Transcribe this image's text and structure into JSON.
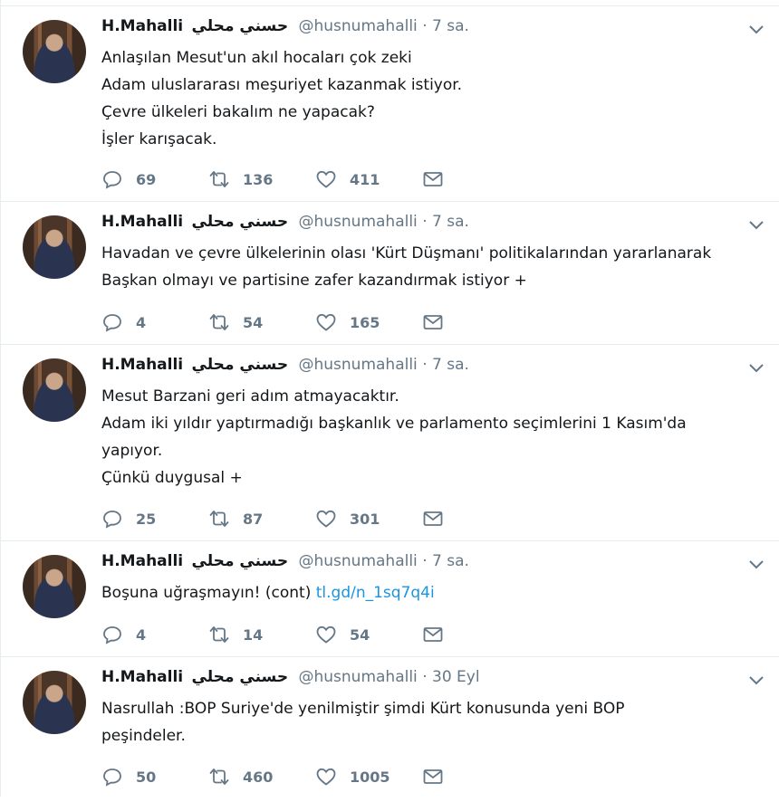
{
  "user": {
    "name": "H.Mahalli",
    "arabic_name": "حسني محلي",
    "handle": "@husnumahalli",
    "separator": "·"
  },
  "icons": {
    "reply": "reply-icon",
    "retweet": "retweet-icon",
    "like": "heart-icon",
    "dm": "direct-message-icon",
    "menu": "chevron-down-icon"
  },
  "colors": {
    "link": "#1b95e0",
    "muted": "#657786",
    "text": "#14171a",
    "divider": "#e6ecf0"
  },
  "tweets": [
    {
      "time": "7 sa.",
      "lines": [
        "Anlaşılan Mesut'un akıl hocaları çok zeki",
        "Adam uluslararası meşuriyet kazanmak istiyor.",
        "Çevre ülkeleri bakalım ne yapacak?",
        "İşler karışacak."
      ],
      "replies": "69",
      "retweets": "136",
      "likes": "411"
    },
    {
      "time": "7 sa.",
      "lines": [
        "Havadan ve çevre ülkelerinin olası 'Kürt Düşmanı' politikalarından yararlanarak",
        "Başkan olmayı ve partisine zafer kazandırmak istiyor +"
      ],
      "replies": "4",
      "retweets": "54",
      "likes": "165"
    },
    {
      "time": "7 sa.",
      "lines": [
        "Mesut Barzani geri adım atmayacaktır.",
        "Adam iki yıldır yaptırmadığı  başkanlık ve parlamento seçimlerini 1 Kasım'da",
        "yapıyor.",
        "Çünkü duygusal +"
      ],
      "replies": "25",
      "retweets": "87",
      "likes": "301"
    },
    {
      "time": "7 sa.",
      "lines": [
        "Boşuna uğraşmayın! (cont) "
      ],
      "link": "tl.gd/n_1sq7q4i",
      "replies": "4",
      "retweets": "14",
      "likes": "54"
    },
    {
      "time": "30 Eyl",
      "lines": [
        "Nasrullah :BOP Suriye'de yenilmiştir şimdi Kürt konusunda yeni BOP",
        "peşindeler."
      ],
      "replies": "50",
      "retweets": "460",
      "likes": "1005"
    }
  ]
}
